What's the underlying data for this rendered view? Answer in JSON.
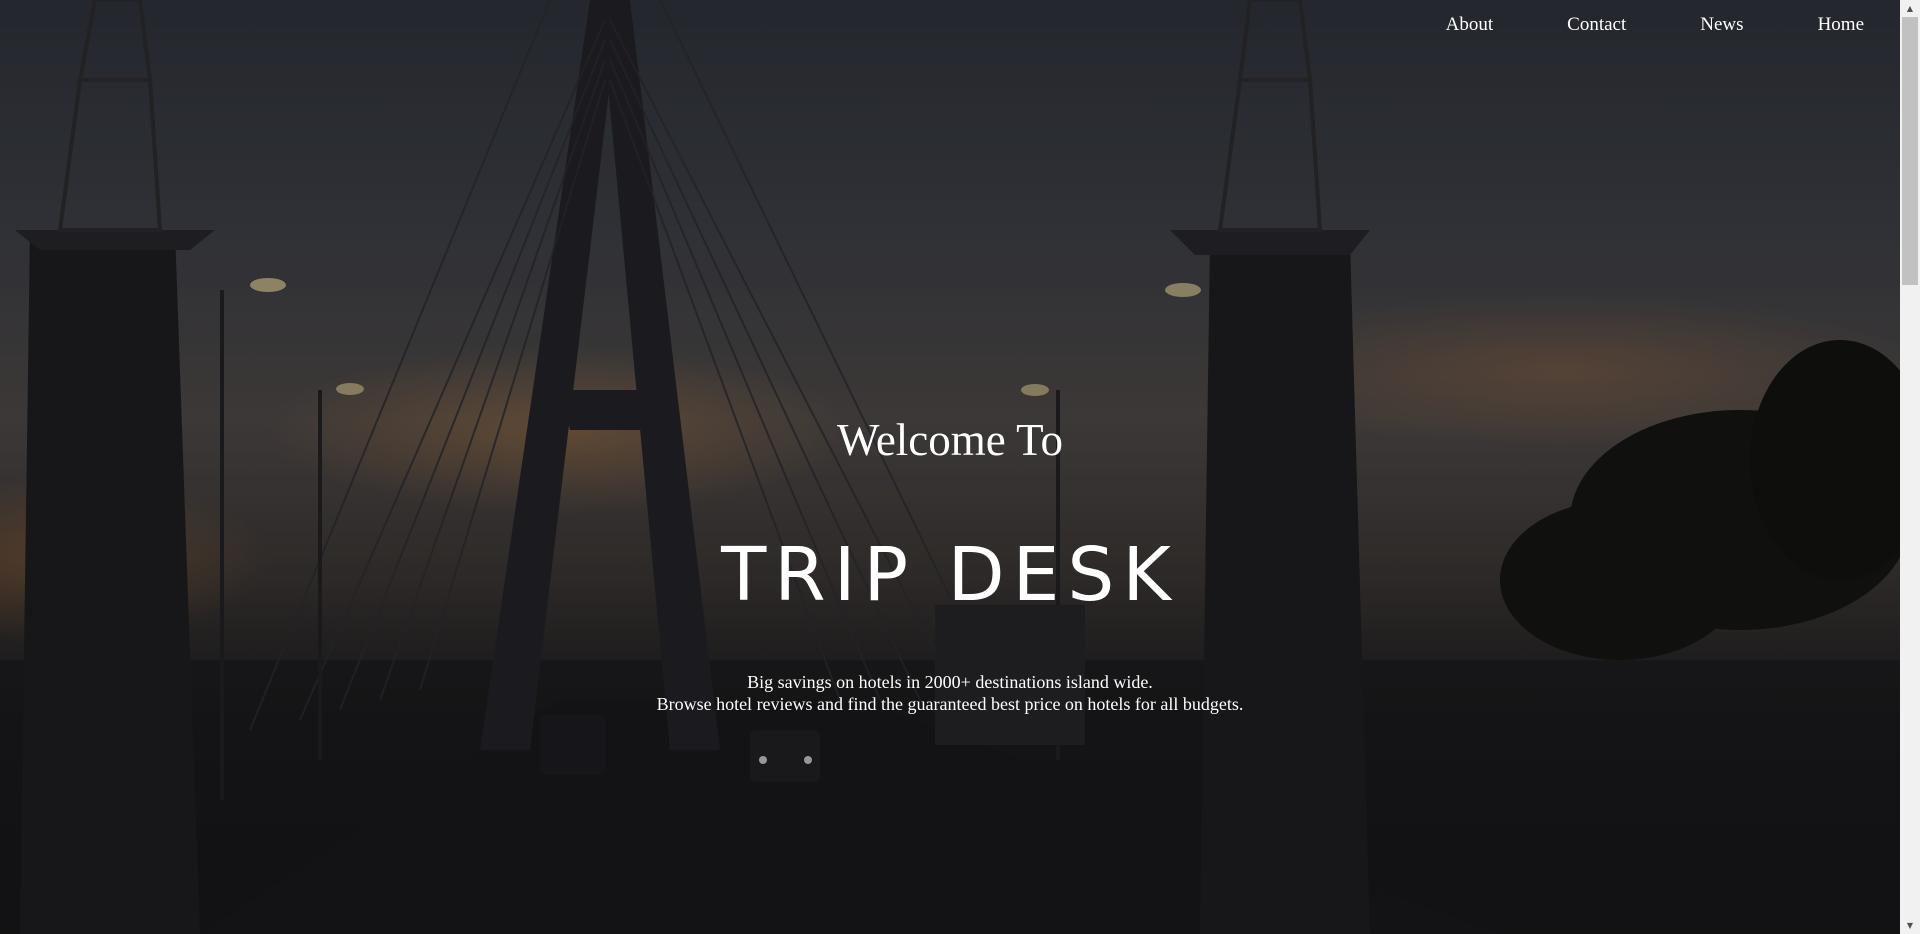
{
  "nav": {
    "items": [
      {
        "label": "About"
      },
      {
        "label": "Contact"
      },
      {
        "label": "News"
      },
      {
        "label": "Home"
      }
    ]
  },
  "hero": {
    "welcome": "Welcome To",
    "brand": "TRIP DESK",
    "tagline_line1": "Big savings on hotels in 2000+ destinations island wide.",
    "tagline_line2": "Browse hotel reviews and find the guaranteed best price on hotels for all budgets."
  },
  "scrollbar": {
    "up_icon": "triangle-up",
    "down_icon": "triangle-down"
  }
}
